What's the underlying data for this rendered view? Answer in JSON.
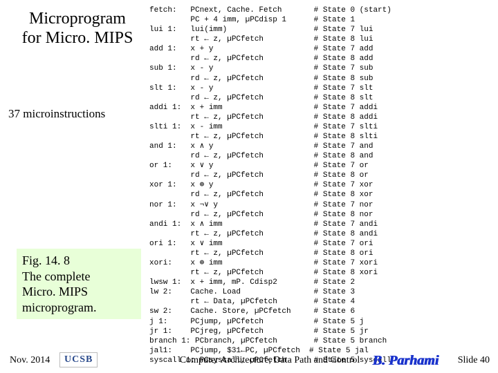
{
  "title_line1": "Microprogram",
  "title_line2": "for Micro. MIPS",
  "subtitle": "37 microinstructions",
  "fig": {
    "num": "Fig. 14. 8",
    "cap1": "The complete",
    "cap2": "Micro. MIPS",
    "cap3": "microprogram."
  },
  "code": "fetch:   PCnext, Cache. Fetch       # State 0 (start)\n         PC + 4 imm, µPCdisp 1      # State 1\nlui 1:   lui(imm)                   # State 7 lui\n         rt ← z, µPCfetch           # State 8 lui\nadd 1:   x + y                      # State 7 add\n         rd ← z, µPCfetch           # State 8 add\nsub 1:   x - y                      # State 7 sub\n         rd ← z, µPCfetch           # State 8 sub\nslt 1:   x - y                      # State 7 slt\n         rd ← z, µPCfetch           # State 8 slt\naddi 1:  x + imm                    # State 7 addi\n         rt ← z, µPCfetch           # State 8 addi\nslti 1:  x - imm                    # State 7 slti\n         rt ← z, µPCfetch           # State 8 slti\nand 1:   x ∧ y                      # State 7 and\n         rd ← z, µPCfetch           # State 8 and\nor 1:    x ∨ y                      # State 7 or\n         rd ← z, µPCfetch           # State 8 or\nxor 1:   x ⊕ y                      # State 7 xor\n         rd ← z, µPCfetch           # State 8 xor\nnor 1:   x ¬∨ y                     # State 7 nor\n         rd ← z, µPCfetch           # State 8 nor\nandi 1:  x ∧ imm                    # State 7 andi\n         rt ← z, µPCfetch           # State 8 andi\nori 1:   x ∨ imm                    # State 7 ori\n         rt ← z, µPCfetch           # State 8 ori\nxori:    x ⊕ imm                    # State 7 xori\n         rt ← z, µPCfetch           # State 8 xori\nlwsw 1:  x + imm, mP. Cdisp2        # State 2\nlw 2:    Cache. Load                # State 3\n         rt ← Data, µPCfetch        # State 4\nsw 2:    Cache. Store, µPCfetch     # State 6\nj 1:     PCjump, µPCfetch           # State 5 j\njr 1:    PCjreg, µPCfetch           # State 5 jr\nbranch 1: PCbranch, µPCfetch        # State 5 branch\njal1:    PCjump, $31←PC, µPCfetch  # State 5 jal\nsyscall 1: PCsyscall, µPCfetch      # State 5 syscall",
  "footer": {
    "date": "Nov. 2014",
    "logo": "UCSB",
    "center": "Computer Architecture, Data Path and Control",
    "author": "B. Parhami",
    "slide": "Slide 40"
  }
}
